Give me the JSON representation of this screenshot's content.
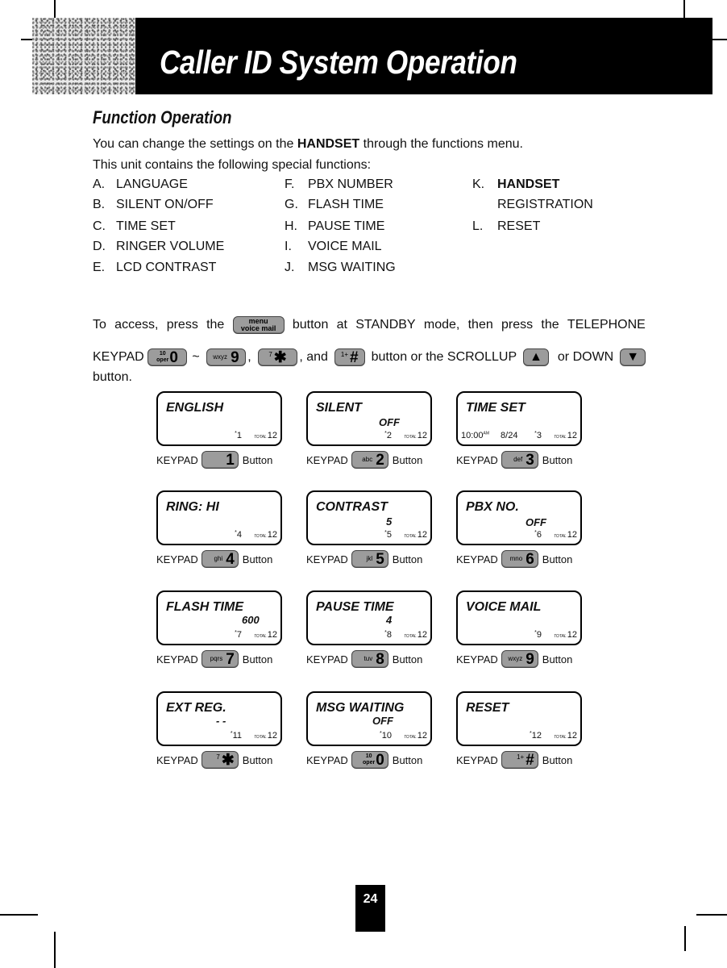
{
  "header": {
    "title": "Caller ID System Operation"
  },
  "section": {
    "title": "Function Operation",
    "intro_pre": "You can change the settings on the ",
    "intro_bold": "HANDSET",
    "intro_post": " through the functions menu.",
    "intro2": "This unit contains the following special functions:"
  },
  "functions": [
    {
      "letter": "A.",
      "label": "LANGUAGE"
    },
    {
      "letter": "B.",
      "label": "SILENT ON/OFF"
    },
    {
      "letter": "C.",
      "label": "TIME SET"
    },
    {
      "letter": "D.",
      "label": "RINGER VOLUME"
    },
    {
      "letter": "E.",
      "label": "LCD CONTRAST"
    },
    {
      "letter": "F.",
      "label": "PBX NUMBER"
    },
    {
      "letter": "G.",
      "label": "FLASH TIME"
    },
    {
      "letter": "H.",
      "label": "PAUSE TIME"
    },
    {
      "letter": "I.",
      "label": "VOICE MAIL"
    },
    {
      "letter": "J.",
      "label": "MSG WAITING"
    },
    {
      "letter": "K.",
      "label": "HANDSET",
      "label2": "REGISTRATION"
    },
    {
      "letter": "L.",
      "label": "RESET"
    }
  ],
  "access": {
    "t1": "To",
    "t2": "access,",
    "t3": "press",
    "t4": "the",
    "menu_key_top": "menu",
    "menu_key_bottom": "voice mail",
    "t5": "button",
    "t6": "at",
    "t7": "STANDBY",
    "t8": "mode,",
    "t9": "then",
    "t10": "press",
    "t11": "the",
    "t12": "TELEPHONE",
    "keypad": "KEYPAD",
    "tilde": "~",
    "comma": ",",
    "and": ", and",
    "scroll_text": "button or the SCROLLUP",
    "or_down": "or DOWN",
    "last": "button.",
    "up_glyph": "▲",
    "down_glyph": "▼"
  },
  "keys": {
    "k0": {
      "top": "10",
      "sub": "oper",
      "main": "0"
    },
    "k9": {
      "sub": "wxyz",
      "main": "9"
    },
    "kstar": {
      "sup": "7",
      "main": "✱"
    },
    "khash": {
      "sup": "1+",
      "main": "#"
    }
  },
  "screens": [
    {
      "title": "ENGLISH",
      "value": "",
      "index": "1",
      "total": "12",
      "key_sub": "",
      "key_main": "1",
      "extra": ""
    },
    {
      "title": "SILENT",
      "value": "OFF",
      "index": "2",
      "total": "12",
      "key_sub": "abc",
      "key_main": "2",
      "extra": ""
    },
    {
      "title": "TIME SET",
      "value": "",
      "index": "3",
      "total": "12",
      "key_sub": "def",
      "key_main": "3",
      "extra": "10:00",
      "extra_sup": "AM",
      "extra2": "8/24"
    },
    {
      "title": "RING: HI",
      "value": "",
      "index": "4",
      "total": "12",
      "key_sub": "ghi",
      "key_main": "4",
      "extra": ""
    },
    {
      "title": "CONTRAST",
      "value": "5",
      "index": "5",
      "total": "12",
      "key_sub": "jkl",
      "key_main": "5",
      "extra": ""
    },
    {
      "title": "PBX NO.",
      "value": "OFF",
      "index": "6",
      "total": "12",
      "key_sub": "mno",
      "key_main": "6",
      "extra": ""
    },
    {
      "title": "FLASH TIME",
      "value": "600",
      "index": "7",
      "total": "12",
      "key_sub": "pqrs",
      "key_main": "7",
      "extra": ""
    },
    {
      "title": "PAUSE TIME",
      "value": "4",
      "index": "8",
      "total": "12",
      "key_sub": "tuv",
      "key_main": "8",
      "extra": ""
    },
    {
      "title": "VOICE MAIL",
      "value": "",
      "index": "9",
      "total": "12",
      "key_sub": "wxyz",
      "key_main": "9",
      "extra": ""
    },
    {
      "title": "EXT REG.",
      "value": "- -",
      "index": "11",
      "total": "12",
      "key_sub": "7",
      "key_main": "✱",
      "extra": ""
    },
    {
      "title": "MSG WAITING",
      "value": "OFF",
      "index": "10",
      "total": "12",
      "key_sub": "oper",
      "key_top": "10",
      "key_main": "0",
      "extra": ""
    },
    {
      "title": "RESET",
      "value": "",
      "index": "12",
      "total": "12",
      "key_sub": "1+",
      "key_main": "#",
      "extra": ""
    }
  ],
  "labels": {
    "keypad": "KEYPAD",
    "button": "Button",
    "total_label": "TOTAL",
    "index_prefix": "*"
  },
  "page_number": "24"
}
